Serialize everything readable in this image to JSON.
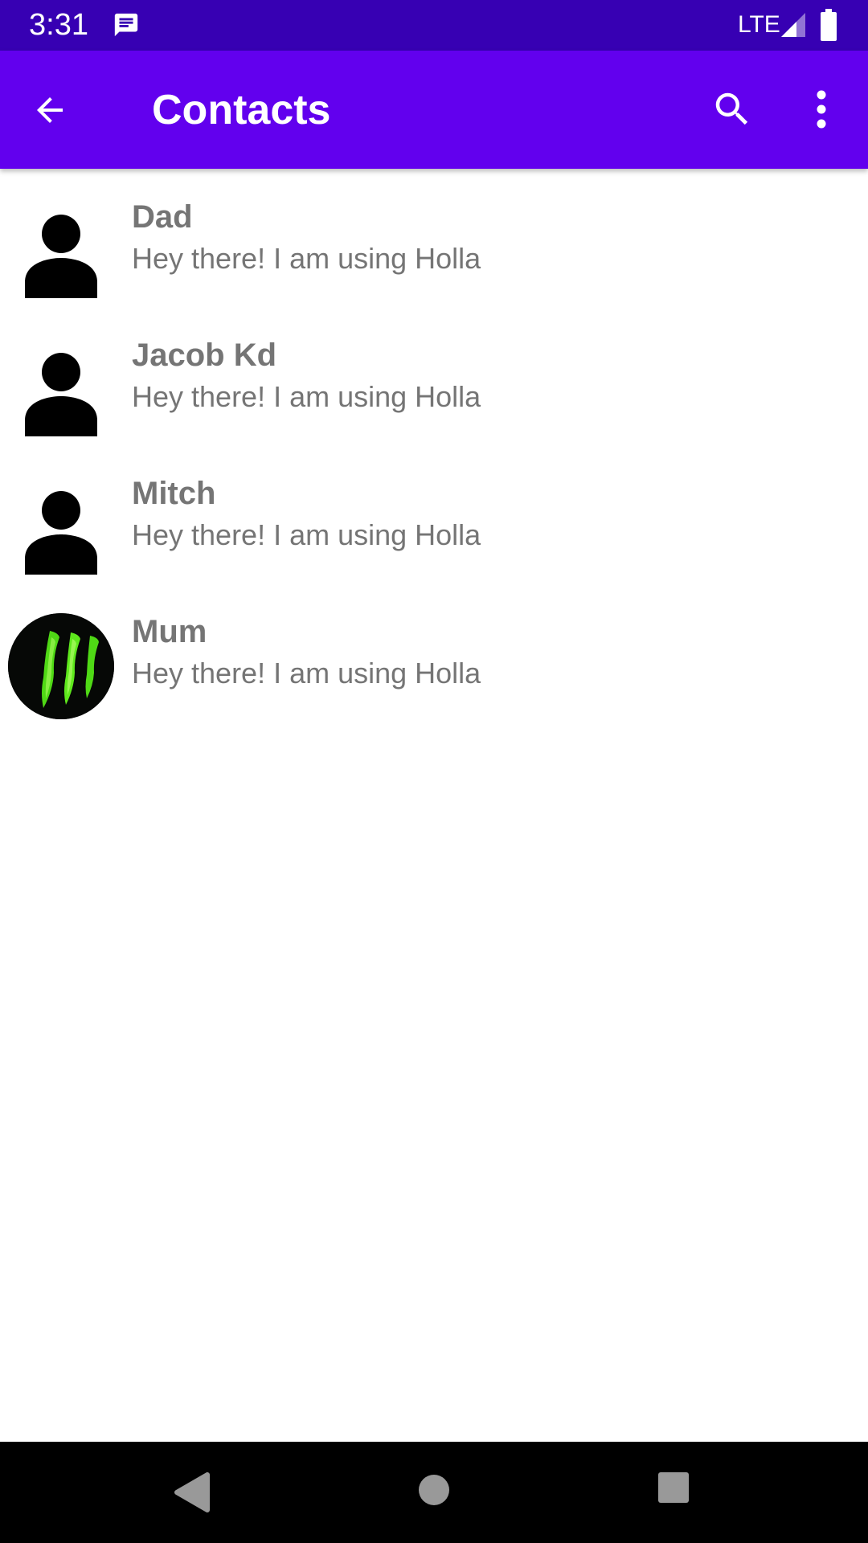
{
  "status_bar": {
    "time": "3:31",
    "network": "LTE",
    "background_color": "#3700b3",
    "icons": [
      "message-notification-icon",
      "signal-icon",
      "battery-icon"
    ]
  },
  "app_bar": {
    "title": "Contacts",
    "background_color": "#6200ee",
    "icons": [
      "back-arrow-icon",
      "search-icon",
      "more-vert-icon"
    ]
  },
  "contacts": [
    {
      "name": "Dad",
      "status": "Hey there! I am using Holla",
      "avatar": "default-person-icon"
    },
    {
      "name": "Jacob Kd",
      "status": "Hey there! I am using Holla",
      "avatar": "default-person-icon"
    },
    {
      "name": "Mitch",
      "status": "Hey there! I am using Holla",
      "avatar": "default-person-icon"
    },
    {
      "name": "Mum",
      "status": "Hey there! I am using Holla",
      "avatar": "green-claw-photo"
    }
  ],
  "nav_bar": {
    "icons": [
      "nav-back-icon",
      "nav-home-icon",
      "nav-recents-icon"
    ]
  }
}
